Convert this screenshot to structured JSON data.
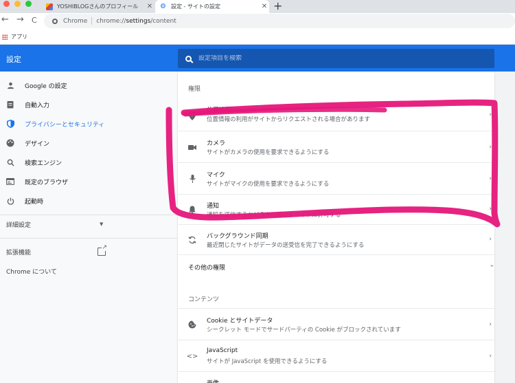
{
  "tabs": [
    {
      "title": "YOSHIBLOGさんのプロフィール",
      "close": "✕"
    },
    {
      "title": "設定 - サイトの設定",
      "close": "✕"
    }
  ],
  "new_tab": "+",
  "toolbar": {
    "back": "←",
    "forward": "→",
    "reload": "C"
  },
  "omnibox": {
    "scheme": "Chrome",
    "url_prefix": "chrome://",
    "url_main": "settings",
    "url_suffix": "/content"
  },
  "bookmarks": {
    "apps_label": "アプリ"
  },
  "header": {
    "title": "設定",
    "search_placeholder": "設定項目を検索"
  },
  "sidebar": {
    "items": [
      {
        "label": "Google の設定",
        "icon": "person-icon"
      },
      {
        "label": "自動入力",
        "icon": "clipboard-icon"
      },
      {
        "label": "プライバシーとセキュリティ",
        "icon": "shield-icon"
      },
      {
        "label": "デザイン",
        "icon": "palette-icon"
      },
      {
        "label": "検索エンジン",
        "icon": "search-icon"
      },
      {
        "label": "既定のブラウザ",
        "icon": "browser-icon"
      },
      {
        "label": "起動時",
        "icon": "power-icon"
      }
    ],
    "advanced": "詳細設定",
    "extensions": "拡張機能",
    "about": "Chrome について"
  },
  "main": {
    "permissions_label": "権限",
    "permissions": [
      {
        "title": "位置情報",
        "subtitle": "位置情報の利用がサイトからリクエストされる場合があります",
        "icon": "location-icon"
      },
      {
        "title": "カメラ",
        "subtitle": "サイトがカメラの使用を要求できるようにする",
        "icon": "camera-icon"
      },
      {
        "title": "マイク",
        "subtitle": "サイトがマイクの使用を要求できるようにする",
        "icon": "mic-icon"
      },
      {
        "title": "通知",
        "subtitle": "通知を送信するかどうかの確認をサイトに許可する",
        "icon": "bell-icon"
      },
      {
        "title": "バックグラウンド同期",
        "subtitle": "最近閉じたサイトがデータの送受信を完了できるようにする",
        "icon": "sync-icon"
      }
    ],
    "more_permissions": "その他の権限",
    "content_label": "コンテンツ",
    "content": [
      {
        "title": "Cookie とサイトデータ",
        "subtitle": "シークレット モードでサードパーティの Cookie がブロックされています",
        "icon": "cookie-icon"
      },
      {
        "title": "JavaScript",
        "subtitle": "サイトが JavaScript を使用できるようにする",
        "icon": "code-icon"
      },
      {
        "title": "画像",
        "subtitle": "",
        "icon": "image-icon"
      }
    ]
  },
  "colors": {
    "accent": "#1a73e8",
    "header_search": "#1557b0",
    "marker": "#e5177a"
  }
}
